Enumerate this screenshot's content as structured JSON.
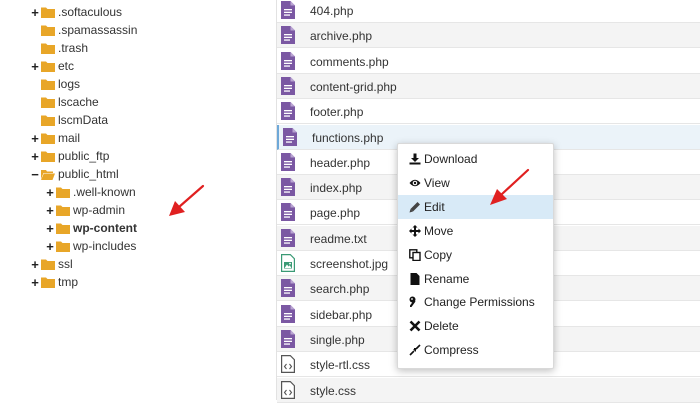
{
  "tree": {
    "items": [
      {
        "label": ".softaculous",
        "toggle": "+",
        "level": 0,
        "bold": false
      },
      {
        "label": ".spamassassin",
        "toggle": "",
        "level": 0,
        "bold": false
      },
      {
        "label": ".trash",
        "toggle": "",
        "level": 0,
        "bold": false
      },
      {
        "label": "etc",
        "toggle": "+",
        "level": 0,
        "bold": false
      },
      {
        "label": "logs",
        "toggle": "",
        "level": 0,
        "bold": false
      },
      {
        "label": "lscache",
        "toggle": "",
        "level": 0,
        "bold": false
      },
      {
        "label": "lscmData",
        "toggle": "",
        "level": 0,
        "bold": false
      },
      {
        "label": "mail",
        "toggle": "+",
        "level": 0,
        "bold": false
      },
      {
        "label": "public_ftp",
        "toggle": "+",
        "level": 0,
        "bold": false
      },
      {
        "label": "public_html",
        "toggle": "−",
        "level": 0,
        "bold": false
      },
      {
        "label": ".well-known",
        "toggle": "+",
        "level": 1,
        "bold": false
      },
      {
        "label": "wp-admin",
        "toggle": "+",
        "level": 1,
        "bold": false
      },
      {
        "label": "wp-content",
        "toggle": "+",
        "level": 1,
        "bold": true
      },
      {
        "label": "wp-includes",
        "toggle": "+",
        "level": 1,
        "bold": false
      },
      {
        "label": "ssl",
        "toggle": "+",
        "level": 0,
        "bold": false
      },
      {
        "label": "tmp",
        "toggle": "+",
        "level": 0,
        "bold": false
      }
    ]
  },
  "files": [
    {
      "name": "404.php",
      "type": "php"
    },
    {
      "name": "archive.php",
      "type": "php"
    },
    {
      "name": "comments.php",
      "type": "php"
    },
    {
      "name": "content-grid.php",
      "type": "php"
    },
    {
      "name": "footer.php",
      "type": "php"
    },
    {
      "name": "functions.php",
      "type": "php",
      "selected": true
    },
    {
      "name": "header.php",
      "type": "php"
    },
    {
      "name": "index.php",
      "type": "php"
    },
    {
      "name": "page.php",
      "type": "php"
    },
    {
      "name": "readme.txt",
      "type": "txt"
    },
    {
      "name": "screenshot.jpg",
      "type": "image"
    },
    {
      "name": "search.php",
      "type": "php"
    },
    {
      "name": "sidebar.php",
      "type": "php"
    },
    {
      "name": "single.php",
      "type": "php"
    },
    {
      "name": "style-rtl.css",
      "type": "css"
    },
    {
      "name": "style.css",
      "type": "css"
    }
  ],
  "context_menu": {
    "items": [
      {
        "label": "Download",
        "icon": "download-icon"
      },
      {
        "label": "View",
        "icon": "eye-icon"
      },
      {
        "label": "Edit",
        "icon": "pencil-icon",
        "highlighted": true
      },
      {
        "label": "Move",
        "icon": "move-icon"
      },
      {
        "label": "Copy",
        "icon": "copy-icon"
      },
      {
        "label": "Rename",
        "icon": "file-icon"
      },
      {
        "label": "Change Permissions",
        "icon": "key-icon"
      },
      {
        "label": "Delete",
        "icon": "x-icon"
      },
      {
        "label": "Compress",
        "icon": "compress-icon"
      }
    ]
  },
  "colors": {
    "folder": "#e8a628",
    "php_icon": "#7b58a3",
    "image_icon": "#3a9a75",
    "annotation_arrow": "#e02020",
    "selected_row": "#ebf3f9",
    "menu_highlight": "#d8eaf7"
  }
}
